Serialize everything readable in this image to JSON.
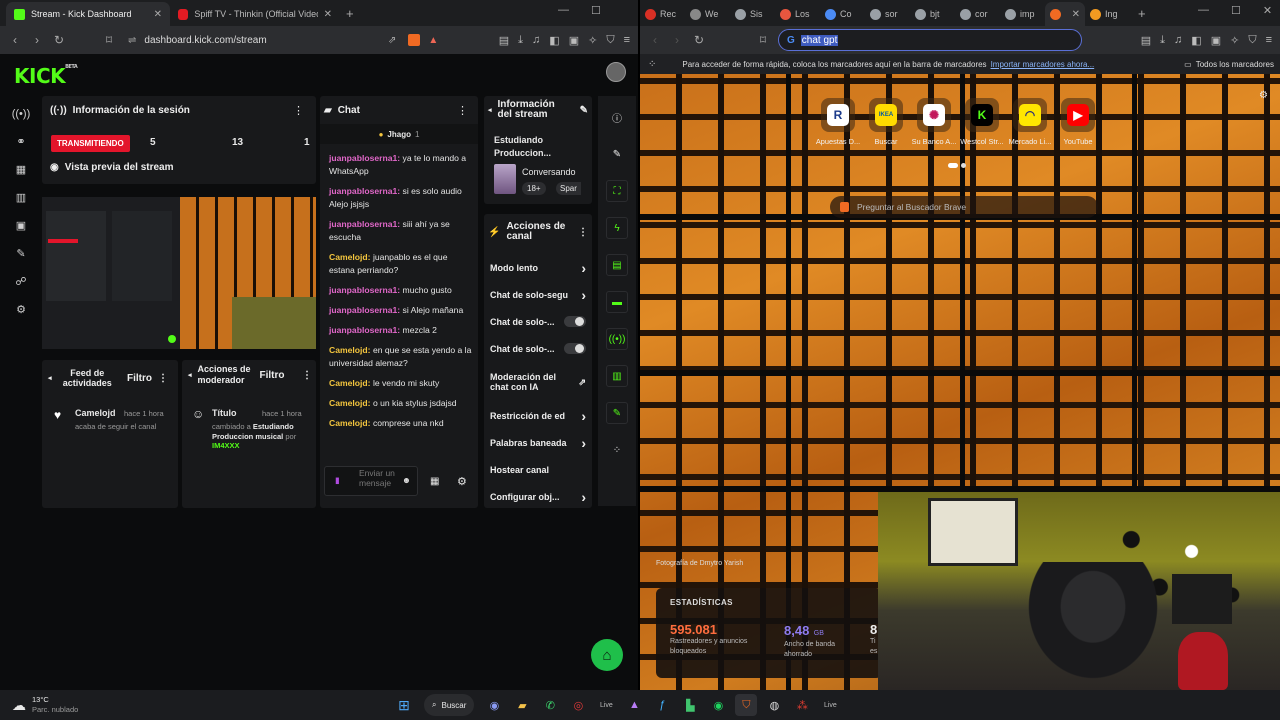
{
  "left_browser": {
    "tabs": [
      {
        "title": "Stream - Kick Dashboard",
        "active": true
      },
      {
        "title": "Spiff TV - Thinkin (Official Video) ft. A",
        "active": false
      }
    ],
    "url": "dashboard.kick.com/stream"
  },
  "kick": {
    "logo": "KICK",
    "logo_badge": "BETA",
    "session": {
      "title": "Información de la sesión",
      "status": "TRANSMITIENDO",
      "stats": [
        "5",
        "13",
        "1"
      ]
    },
    "preview": {
      "title": "Vista previa del stream"
    },
    "activity": {
      "title": "Feed de actividades",
      "filter": "Filtro",
      "item": {
        "user": "Camelojd",
        "time": "hace 1 hora",
        "text": "acaba de seguir el canal"
      }
    },
    "mod_actions": {
      "title": "Acciones de moderador",
      "filter": "Filtro",
      "item": {
        "label": "Título",
        "time": "hace 1 hora",
        "text_pre": "cambiado a",
        "text_value": "Estudiando Produccion musical",
        "text_by": "por",
        "moderator": "IM4XXX"
      }
    },
    "chat": {
      "title": "Chat",
      "pinned_user": "Jhago",
      "pinned_count": "1",
      "messages": [
        {
          "user": "juanpabloserna1:",
          "text": "ya te lo mando a WhatsApp",
          "color": "pink"
        },
        {
          "user": "juanpabloserna1:",
          "text": "si es solo audio Alejo jsjsjs",
          "color": "pink"
        },
        {
          "user": "juanpabloserna1:",
          "text": "siii ahí ya se escucha",
          "color": "pink"
        },
        {
          "user": "Camelojd:",
          "text": "juanpablo es el que estana perriando?",
          "color": "gold"
        },
        {
          "user": "juanpabloserna1:",
          "text": "mucho gusto",
          "color": "pink"
        },
        {
          "user": "juanpabloserna1:",
          "text": "si Alejo mañana",
          "color": "pink"
        },
        {
          "user": "juanpabloserna1:",
          "text": "mezcla 2",
          "color": "pink"
        },
        {
          "user": "Camelojd:",
          "text": "en que se esta yendo a la universidad alemaz?",
          "color": "gold"
        },
        {
          "user": "Camelojd:",
          "text": "le vendo mi skuty",
          "color": "gold"
        },
        {
          "user": "Camelojd:",
          "text": "o un kia stylus jsdajsd",
          "color": "gold"
        },
        {
          "user": "Camelojd:",
          "text": "comprese una nkd",
          "color": "gold"
        }
      ],
      "input_placeholder": "Enviar un mensaje"
    },
    "stream_info": {
      "title": "Información del stream",
      "stream_title": "Estudiando Produccion...",
      "category": "Conversando",
      "tags": [
        "18+",
        "Spar"
      ]
    },
    "channel_actions": {
      "title": "Acciones de canal",
      "items": [
        {
          "label": "Modo lento",
          "control": "arrow"
        },
        {
          "label": "Chat de solo-segu",
          "control": "arrow"
        },
        {
          "label": "Chat de solo-...",
          "control": "toggle"
        },
        {
          "label": "Chat de solo-...",
          "control": "toggle"
        },
        {
          "label": "Moderación del chat con IA",
          "control": "external"
        },
        {
          "label": "Restricción de ed",
          "control": "arrow"
        },
        {
          "label": "Palabras baneada",
          "control": "arrow"
        },
        {
          "label": "Hostear canal",
          "control": "none"
        },
        {
          "label": "Configurar obj...",
          "control": "arrow"
        }
      ]
    }
  },
  "right_browser": {
    "tabs": [
      "Rec",
      "We",
      "Sis",
      "Los",
      "Co",
      "sor",
      "bjt",
      "cor",
      "imp",
      "",
      "Ing"
    ],
    "url_selected": "chat gpt",
    "bookmarks_hint": "Para acceder de forma rápida, coloca los marcadores aquí en la barra de marcadores",
    "bookmarks_import": "Importar marcadores ahora...",
    "bookmarks_all": "Todos los marcadores",
    "shortcuts": [
      "Apuestas D...",
      "Buscar",
      "Su Banco A...",
      "Westcol Str...",
      "Mercado Li...",
      "YouTube"
    ],
    "search_placeholder": "Preguntar al Buscador Brave",
    "photo_credit": "Fotografía de Dmytro Yarish",
    "stats": {
      "title": "ESTADÍSTICAS",
      "blocked": "595.081",
      "blocked_label": "Rastreadores y anuncios bloqueados",
      "bandwidth": "8,48",
      "bandwidth_unit": "GB",
      "bandwidth_label": "Ancho de banda ahorrado",
      "third": "8",
      "third_label": "Ti es"
    }
  },
  "taskbar": {
    "weather_temp": "13°C",
    "weather_desc": "Parc. nublado",
    "search_label": "Buscar"
  }
}
